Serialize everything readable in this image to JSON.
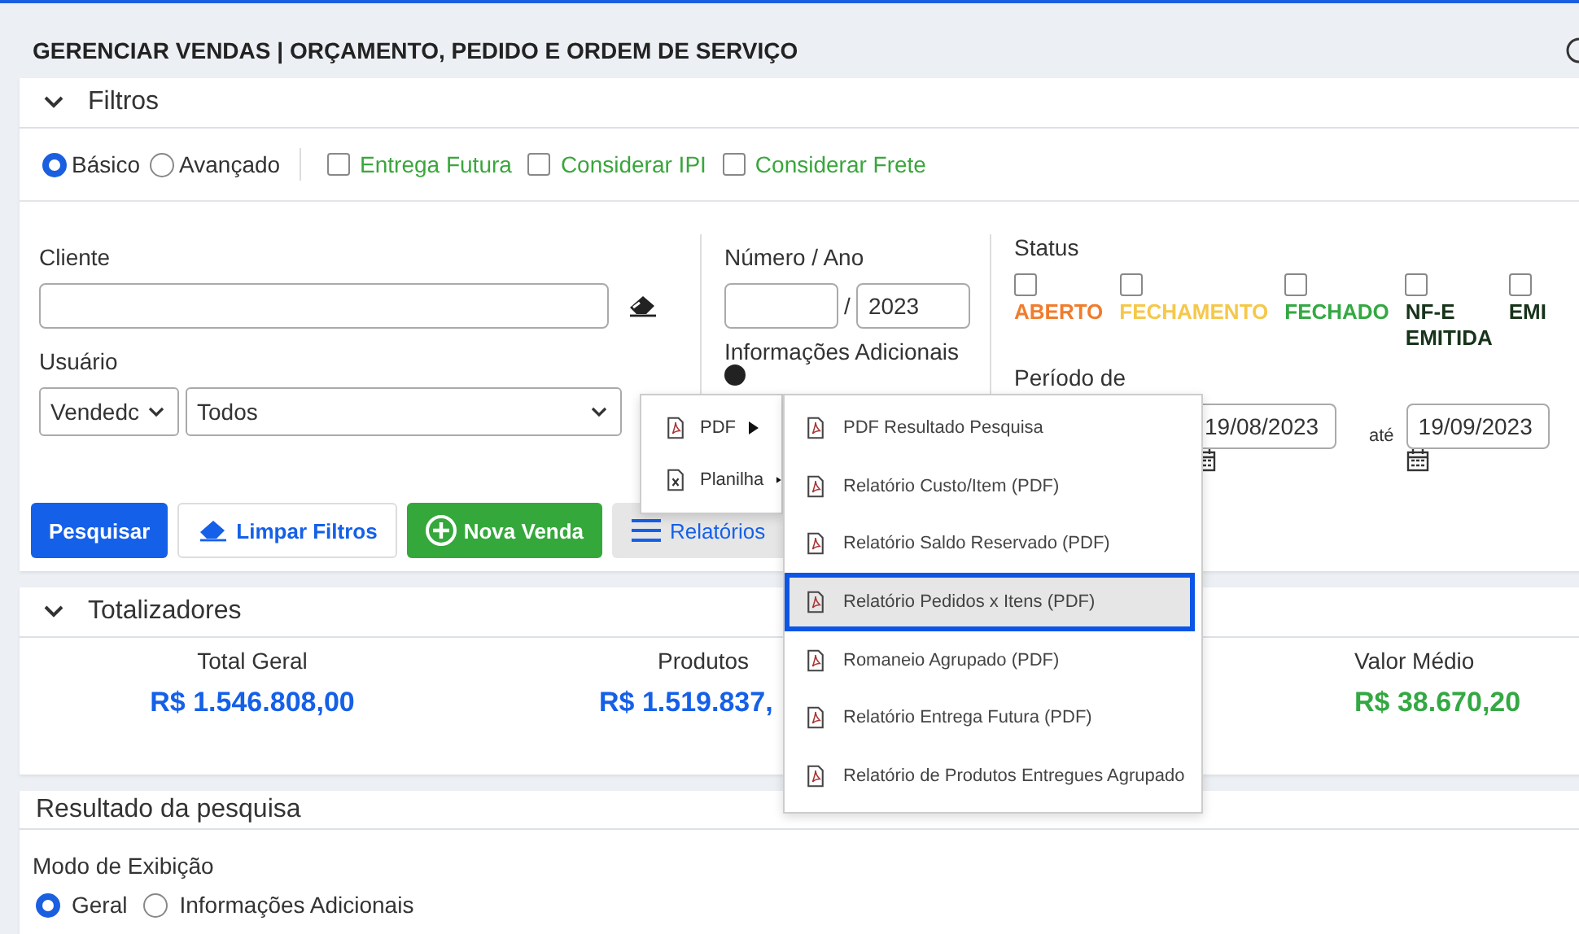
{
  "page_title": "GERENCIAR VENDAS | ORÇAMENTO, PEDIDO E ORDEM DE SERVIÇO",
  "filters": {
    "title": "Filtros",
    "expanded": true,
    "modes": [
      {
        "label": "Básico",
        "selected": true
      },
      {
        "label": "Avançado",
        "selected": false
      }
    ],
    "options": [
      {
        "label": "Entrega Futura",
        "checked": false
      },
      {
        "label": "Considerar IPI",
        "checked": false
      },
      {
        "label": "Considerar Frete",
        "checked": false
      }
    ],
    "cliente_label": "Cliente",
    "usuario": {
      "label": "Usuário",
      "type_select": "Vendedc",
      "user_select": "Todos"
    },
    "numero_ano": {
      "label": "Número / Ano",
      "separator": "/",
      "year": "2023"
    },
    "info_label": "Informações Adicionais",
    "status": {
      "label": "Status",
      "items": [
        {
          "label": "ABERTO",
          "color": "#f07c2c",
          "checked": false
        },
        {
          "label": "FECHAMENTO",
          "color": "#f5c84a",
          "checked": false
        },
        {
          "label": "FECHADO",
          "color": "#34a843",
          "checked": false
        },
        {
          "label": "NF-E EMITIDA",
          "color": "#17331a",
          "checked": false
        },
        {
          "label": "EMI",
          "color": "#17331a",
          "checked": false
        }
      ]
    },
    "periodo": {
      "label": "Período de",
      "from": "19/08/2023",
      "until_label": "até",
      "to": "19/09/2023"
    },
    "buttons": [
      {
        "kind": "primary",
        "label": "Pesquisar"
      },
      {
        "kind": "outline",
        "label": "Limpar Filtros"
      },
      {
        "kind": "success",
        "label": "Nova Venda"
      },
      {
        "kind": "menu",
        "label": "Relatórios"
      }
    ]
  },
  "reports_menu": {
    "items": [
      {
        "label": "PDF",
        "kind": "pdf"
      },
      {
        "label": "Planilha",
        "kind": "sheet"
      }
    ],
    "submenu": [
      {
        "label": "PDF Resultado Pesquisa",
        "selected": false
      },
      {
        "label": "Relatório Custo/Item (PDF)",
        "selected": false
      },
      {
        "label": "Relatório Saldo Reservado (PDF)",
        "selected": false
      },
      {
        "label": "Relatório Pedidos x Itens (PDF)",
        "selected": true
      },
      {
        "label": "Romaneio Agrupado (PDF)",
        "selected": false
      },
      {
        "label": "Relatório Entrega Futura (PDF)",
        "selected": false
      },
      {
        "label": "Relatório de Produtos Entregues Agrupado",
        "selected": false
      }
    ]
  },
  "totals": {
    "title": "Totalizadores",
    "expanded": true,
    "items": [
      {
        "label": "Total Geral",
        "value": "R$ 1.546.808,00",
        "color": "#1560e8"
      },
      {
        "label": "Produtos",
        "value": "R$ 1.519.837,",
        "color": "#1560e8"
      },
      {
        "label": "Valor Médio",
        "value": "R$ 38.670,20",
        "color": "#34a843"
      }
    ]
  },
  "results": {
    "title": "Resultado da pesquisa",
    "mode_label": "Modo de Exibição",
    "modes": [
      {
        "label": "Geral",
        "selected": true
      },
      {
        "label": "Informações Adicionais",
        "selected": false
      }
    ]
  }
}
